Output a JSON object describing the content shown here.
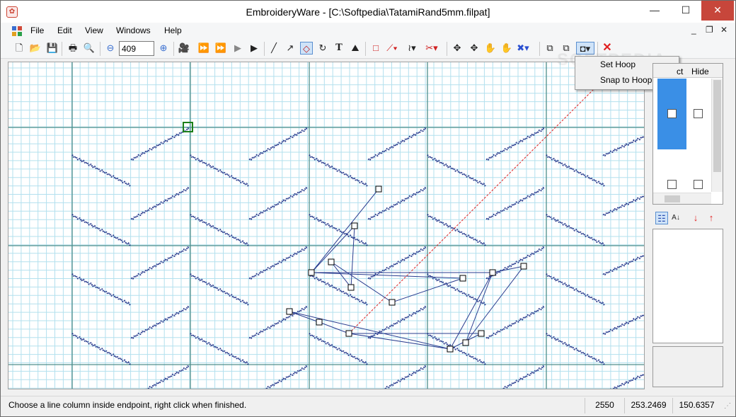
{
  "window": {
    "title": "EmbroideryWare - [C:\\Softpedia\\TatamiRand5mm.filpat]",
    "minimize_glyph": "—",
    "maximize_glyph": "☐",
    "close_glyph": "✕"
  },
  "menubar": {
    "items": [
      "File",
      "Edit",
      "View",
      "Windows",
      "Help"
    ],
    "mdi_minimize": "_",
    "mdi_restore": "❐",
    "mdi_close": "✕"
  },
  "toolbar": {
    "zoom_value": "409",
    "icons": [
      "new-icon",
      "open-icon",
      "save-icon",
      "print-icon",
      "print-preview-icon",
      "zoom-out-icon",
      "zoom-in-icon",
      "camera-icon",
      "play-fast-icon",
      "play-icon",
      "step-icon",
      "step-end-icon",
      "line-icon",
      "curve-icon",
      "fill-icon",
      "rotate-icon",
      "text-icon",
      "stamp-icon",
      "box-icon",
      "stitch-line-icon",
      "wave-icon",
      "cut-icon",
      "move-icon",
      "move-all-icon",
      "hand-icon",
      "pan-icon",
      "delete-points-icon",
      "add-box-icon",
      "remove-box-icon",
      "hoop-icon",
      "close-red-icon"
    ]
  },
  "hoop_menu": {
    "items": [
      "Set Hoop",
      "Snap to Hoop"
    ]
  },
  "layers_panel": {
    "header_partial": "ct",
    "header_hide": "Hide"
  },
  "property_toolbar": {
    "icons": [
      "categorized-icon",
      "alphabetical-icon",
      "arrow-down-icon",
      "arrow-up-icon"
    ]
  },
  "statusbar": {
    "message": "Choose a line column inside endpoint, right click when finished.",
    "field1": "2550",
    "field2": "253.2469",
    "field3": "150.6357"
  },
  "watermark": "SOFTPEDIA",
  "colors": {
    "grid_minor": "#b3e0ee",
    "grid_major": "#4f8f8c",
    "stitch": "#2a3d8f",
    "guide_line": "#e02020",
    "selection_box": "#1a7f1a",
    "layer_selected": "#3a8fe6"
  }
}
